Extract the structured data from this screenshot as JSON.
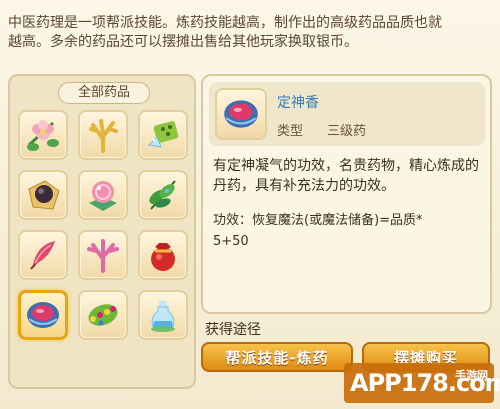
{
  "intro": {
    "line1": "中医药理是一项帮派技能。炼药技能越高，制作出的高级药品品质也就",
    "line2": "越高。多余的药品还可以摆摊出售给其他玩家换取银币。"
  },
  "inventory": {
    "title": "全部药品",
    "items": [
      {
        "icon": "flower-icon"
      },
      {
        "icon": "coral-yellow-icon"
      },
      {
        "icon": "jade-box-icon"
      },
      {
        "icon": "black-pill-icon"
      },
      {
        "icon": "pink-sphere-icon"
      },
      {
        "icon": "green-leaves-icon"
      },
      {
        "icon": "red-feather-icon"
      },
      {
        "icon": "pink-coral-icon"
      },
      {
        "icon": "red-pouch-icon"
      },
      {
        "icon": "incense-bowl-icon",
        "selected": true
      },
      {
        "icon": "green-beads-icon"
      },
      {
        "icon": "potion-bottle-icon"
      }
    ]
  },
  "detail": {
    "name": "定神香",
    "type_label": "类型",
    "type_value": "三级药",
    "description": "有定神凝气的功效，名贵药物，精心炼成的丹药，具有补充法力的功效。",
    "effect_line1": "功效：恢复魔法(或魔法储备)=品质*",
    "effect_line2": "5+50"
  },
  "obtain": {
    "title": "获得途径",
    "buttons": [
      "帮派技能-炼药",
      "摆摊购买"
    ]
  },
  "watermark": {
    "text": "APP178.com",
    "sub": "手游网"
  },
  "colors": {
    "accent": "#e8a510",
    "name_blue": "#2f7fb8",
    "button_orange": "#df8a12"
  }
}
